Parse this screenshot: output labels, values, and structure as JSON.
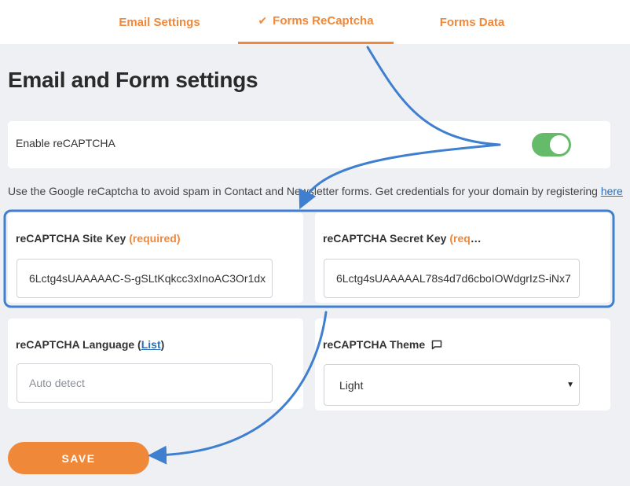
{
  "tabs": [
    {
      "label": "Email Settings",
      "active": false
    },
    {
      "label": "Forms ReCaptcha",
      "active": true,
      "icon": "check-icon"
    },
    {
      "label": "Forms Data",
      "active": false
    }
  ],
  "page_title": "Email and Form settings",
  "enable": {
    "label": "Enable reCAPTCHA",
    "enabled": true
  },
  "info": {
    "text": "Use the Google reCaptcha to avoid spam in Contact and Newsletter forms. Get credentials for your domain by registering ",
    "link": "here"
  },
  "site_key": {
    "label": "reCAPTCHA Site Key ",
    "required": "(required)",
    "value": "6Lctg4sUAAAAAC-S-gSLtKqkcc3xInoAC3Or1dx"
  },
  "secret_key": {
    "label": "reCAPTCHA Secret Key ",
    "required": "(required)",
    "value": "6Lctg4sUAAAAAL78s4d7d6cboIOWdgrIzS-iNx7"
  },
  "language": {
    "label": "reCAPTCHA Language (",
    "link": "List",
    "label_end": ")",
    "placeholder": "Auto detect"
  },
  "theme": {
    "label": "reCAPTCHA Theme",
    "icon": "chat-bubble-icon",
    "selected": "Light"
  },
  "save_label": "SAVE",
  "colors": {
    "accent": "#f0883a",
    "toggle_on": "#66bb6a",
    "annotation_blue": "#3f7fd0",
    "link": "#2a6fb8"
  }
}
